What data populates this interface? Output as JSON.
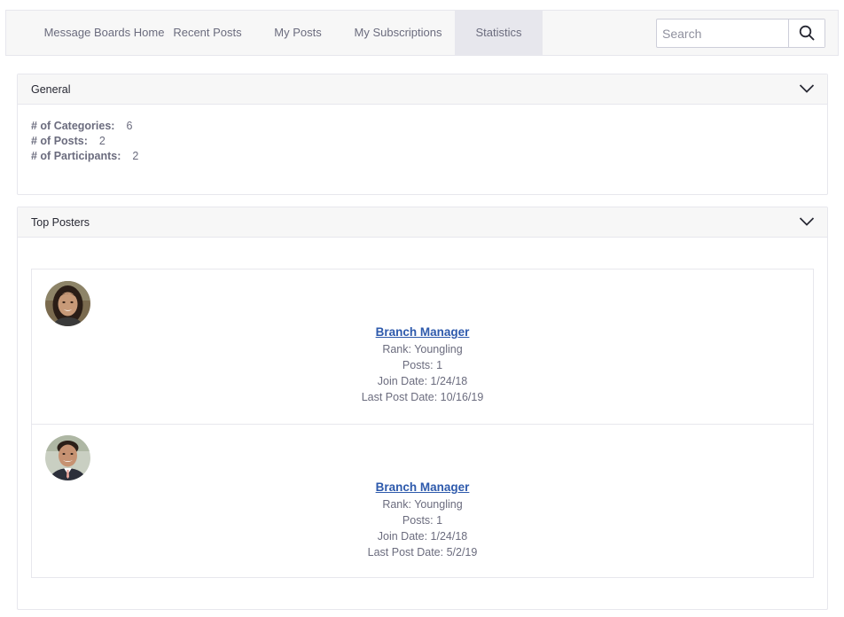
{
  "nav": {
    "items": [
      {
        "label": "Message Boards Home"
      },
      {
        "label": "Recent Posts"
      },
      {
        "label": "My Posts"
      },
      {
        "label": "My Subscriptions"
      },
      {
        "label": "Statistics",
        "active": true
      }
    ],
    "search": {
      "placeholder": "Search",
      "value": ""
    }
  },
  "general": {
    "title": "General",
    "stats": [
      {
        "label": "# of Categories:",
        "value": "6"
      },
      {
        "label": "# of Posts:",
        "value": "2"
      },
      {
        "label": "# of Participants:",
        "value": "2"
      }
    ]
  },
  "top_posters": {
    "title": "Top Posters",
    "posters": [
      {
        "name": "Branch Manager",
        "rank": "Rank: Youngling",
        "posts": "Posts: 1",
        "join_date": "Join Date: 1/24/18",
        "last_post_date": "Last Post Date: 10/16/19"
      },
      {
        "name": "Branch Manager",
        "rank": "Rank: Youngling",
        "posts": "Posts: 1",
        "join_date": "Join Date: 1/24/18",
        "last_post_date": "Last Post Date: 5/2/19"
      }
    ]
  },
  "colors": {
    "link": "#2e5aac",
    "text": "#6b6c7e",
    "header_bg": "#f7f7f7",
    "active_tab_bg": "#e7e7ed",
    "border": "#e7e7ed"
  }
}
